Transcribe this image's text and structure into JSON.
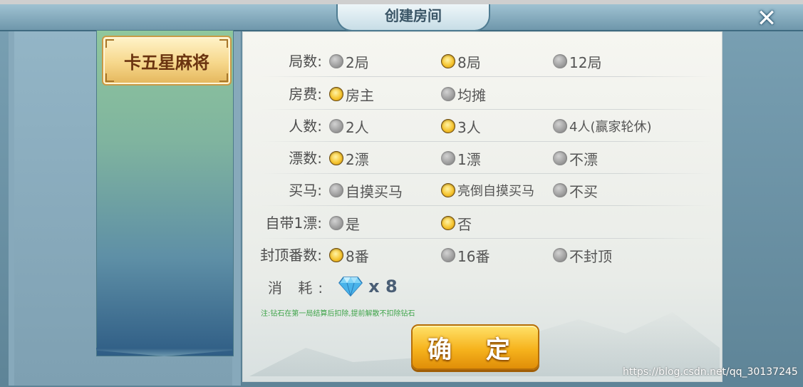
{
  "title": "创建房间",
  "close_label": "✕",
  "sidebar": {
    "tab_label": "卡五星麻将"
  },
  "rows": [
    {
      "label": "局数:",
      "options": [
        {
          "text": "2局",
          "on": false
        },
        {
          "text": "8局",
          "on": true
        },
        {
          "text": "12局",
          "on": false
        }
      ]
    },
    {
      "label": "房费:",
      "options": [
        {
          "text": "房主",
          "on": true
        },
        {
          "text": "均摊",
          "on": false
        }
      ]
    },
    {
      "label": "人数:",
      "options": [
        {
          "text": "2人",
          "on": false
        },
        {
          "text": "3人",
          "on": true
        },
        {
          "text": "4人(赢家轮休)",
          "on": false
        }
      ]
    },
    {
      "label": "漂数:",
      "options": [
        {
          "text": "2漂",
          "on": true
        },
        {
          "text": "1漂",
          "on": false
        },
        {
          "text": "不漂",
          "on": false
        }
      ]
    },
    {
      "label": "买马:",
      "options": [
        {
          "text": "自摸买马",
          "on": false
        },
        {
          "text": "亮倒自摸买马",
          "on": true
        },
        {
          "text": "不买",
          "on": false
        }
      ]
    },
    {
      "label": "自带1漂:",
      "options": [
        {
          "text": "是",
          "on": false
        },
        {
          "text": "否",
          "on": true
        }
      ]
    },
    {
      "label": "封顶番数:",
      "options": [
        {
          "text": "8番",
          "on": true
        },
        {
          "text": "16番",
          "on": false
        },
        {
          "text": "不封顶",
          "on": false
        }
      ]
    }
  ],
  "cost": {
    "label": "消 耗:",
    "value": "x 8",
    "icon": "diamond-icon"
  },
  "note": "注:钻石在第一局结算后扣除,提前解散不扣除钻石",
  "confirm_label": "确 定",
  "watermark": "https://blog.csdn.net/qq_30137245",
  "colors": {
    "accent_gold": "#f6c531",
    "confirm_orange": "#f6b31d",
    "note_green": "#3fa44a"
  }
}
